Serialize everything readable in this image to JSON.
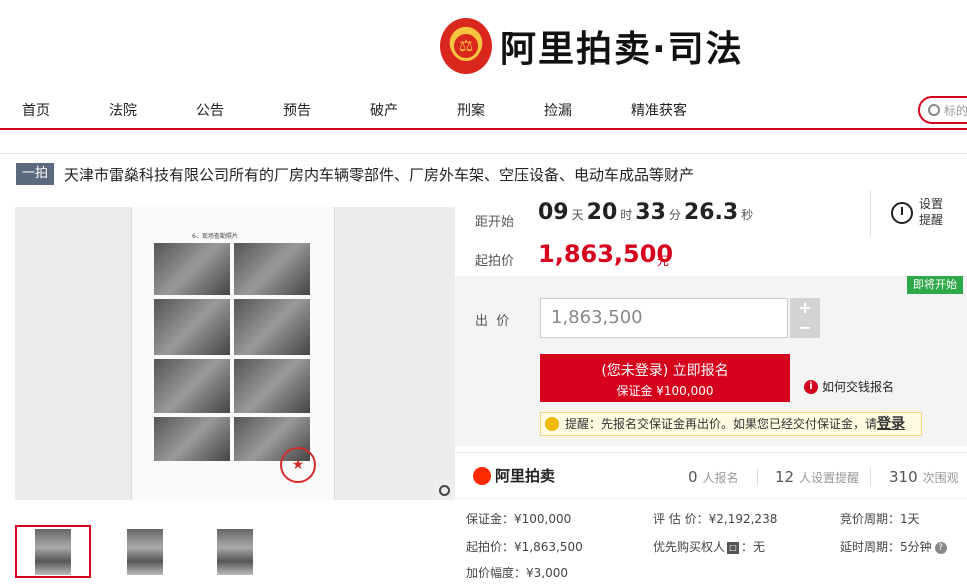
{
  "header": {
    "logo_text": "阿里拍卖·司法",
    "search_placeholder": "标的"
  },
  "nav": [
    "首页",
    "法院",
    "公告",
    "预告",
    "破产",
    "刑案",
    "捡漏",
    "精准获客"
  ],
  "item": {
    "tag": "一拍",
    "title": "天津市雷燊科技有限公司所有的厂房内车辆零部件、厂房外车架、空压设备、电动车成品等财产",
    "doc_header": "6、现场查勘照片"
  },
  "countdown": {
    "label": "距开始",
    "days": "09",
    "days_unit": "天",
    "hours": "20",
    "hours_unit": "时",
    "minutes": "33",
    "minutes_unit": "分",
    "seconds": "26.3",
    "seconds_unit": "秒"
  },
  "remind": {
    "label": "设置提醒"
  },
  "start_price": {
    "label": "起拍价",
    "value": "1,863,500",
    "unit": "元"
  },
  "bid": {
    "label": "出  价",
    "input_value": "1,863,500",
    "plus": "+",
    "minus": "−",
    "soon_badge": "即将开始",
    "signup_line1": "(您未登录) 立即报名",
    "signup_line2": "保证金 ¥100,000",
    "howpay": "如何交钱报名",
    "tip_text": "提醒：先报名交保证金再出价。如果您已经交付保证金，请",
    "tip_login": "登录"
  },
  "stats": {
    "logo": "阿里拍卖",
    "signups": "0",
    "signups_unit": "人报名",
    "reminders": "12",
    "reminders_unit": "人设置提醒",
    "views": "310",
    "views_unit": "次围观"
  },
  "info": {
    "deposit": "保证金：¥100,000",
    "appraisal": "评 估 价：¥2,192,238",
    "bid_period": "竞价周期：1天",
    "start_price": "起拍价：¥1,863,500",
    "priority_buyer": "优先购买权人",
    "priority_value": "：无",
    "delay_period": "延时周期：5分钟",
    "increment": "加价幅度：¥3,000"
  },
  "colors": {
    "brand_red": "#d6001c",
    "green_badge": "#2ea94a",
    "tag_bg": "#5b6a7f"
  }
}
